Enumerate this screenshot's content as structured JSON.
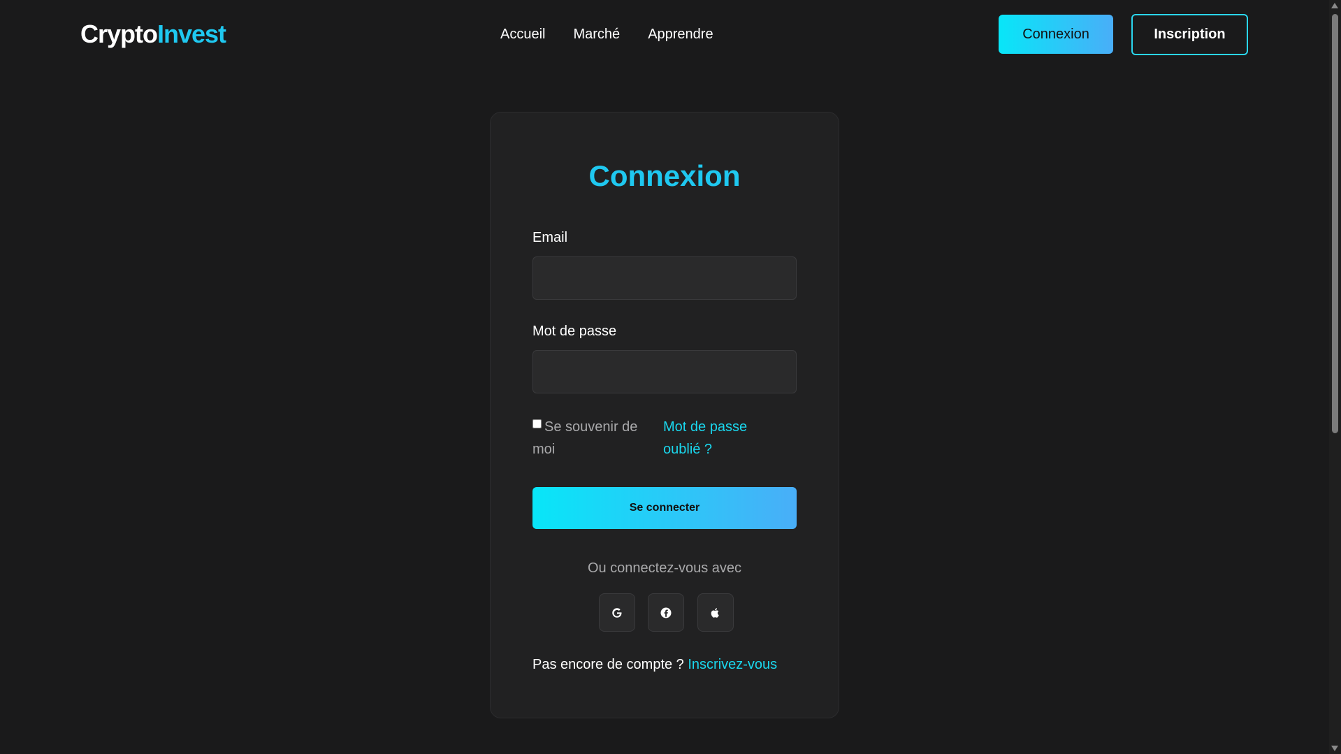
{
  "header": {
    "logo_part1": "Crypto",
    "logo_part2": "Invest",
    "nav": [
      "Accueil",
      "Marché",
      "Apprendre"
    ],
    "login_label": "Connexion",
    "signup_label": "Inscription"
  },
  "form": {
    "title": "Connexion",
    "email_label": "Email",
    "email_value": "",
    "password_label": "Mot de passe",
    "password_value": "",
    "remember_label": "Se souvenir de moi",
    "remember_checked": false,
    "forgot_label": "Mot de passe oublié ?",
    "submit_label": "Se connecter",
    "or_text": "Ou connectez-vous avec",
    "social": [
      "google-icon",
      "facebook-icon",
      "apple-icon"
    ],
    "no_account_text": "Pas encore de compte ?",
    "signup_link": "Inscrivez-vous"
  },
  "colors": {
    "background": "#1a1a1b",
    "card": "#212122",
    "accent": "#1fc8f0",
    "gradient_start": "#08e6f8",
    "gradient_end": "#49aef8"
  }
}
